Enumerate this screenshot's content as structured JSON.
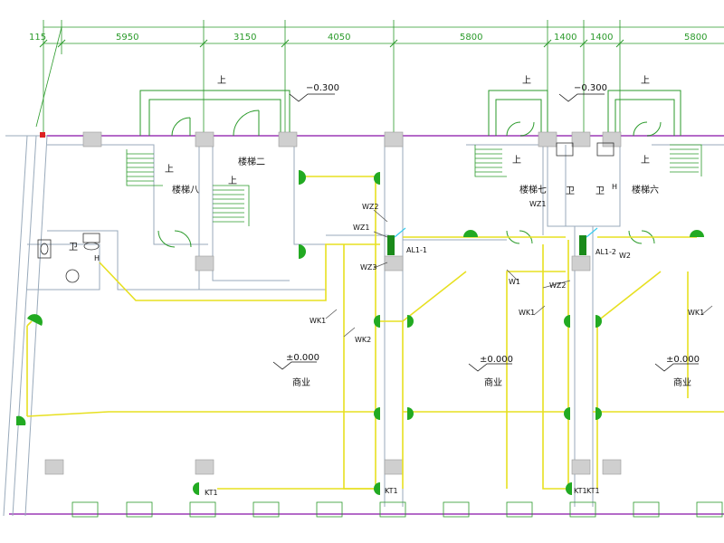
{
  "dimensions": {
    "first": "115",
    "spans": [
      "5950",
      "3150",
      "4050",
      "5800",
      "1400",
      "1400",
      "5800"
    ]
  },
  "levels": {
    "top_left": "−0.300",
    "top_right": "−0.300",
    "floor_1": "±0.000",
    "floor_2": "±0.000",
    "floor_3": "±0.000"
  },
  "stairs": {
    "stair_8": "楼梯八",
    "stair_2": "楼梯二",
    "stair_7": "楼梯七",
    "stair_6": "楼梯六"
  },
  "up_marks": [
    "上"
  ],
  "rooms": {
    "shop": "商业",
    "toilet": "卫"
  },
  "panels": {
    "al1_1": "AL1-1",
    "al1_2": "AL1-2"
  },
  "circuits": {
    "wz1": "WZ1",
    "wz2": "WZ2",
    "wz3": "WZ3",
    "w1": "W1",
    "w2": "W2",
    "wk1": "WK1",
    "wk2": "WK2",
    "kt1": "KT1",
    "h": "H"
  }
}
